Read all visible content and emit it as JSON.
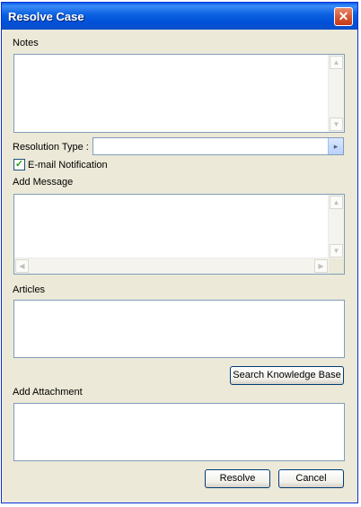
{
  "window": {
    "title": "Resolve Case",
    "close_glyph": "✕"
  },
  "notes": {
    "label": "Notes",
    "value": ""
  },
  "resolution": {
    "label": "Resolution Type :",
    "value": "",
    "arrow": "▸"
  },
  "email": {
    "label": "E-mail Notification",
    "checked": true,
    "check_glyph": "✓"
  },
  "message": {
    "label": "Add Message",
    "value": ""
  },
  "articles": {
    "label": "Articles"
  },
  "search_kb": {
    "label": "Search Knowledge Base"
  },
  "attachment": {
    "label": "Add Attachment"
  },
  "buttons": {
    "resolve": "Resolve",
    "cancel": "Cancel"
  },
  "scroll_glyphs": {
    "up": "▲",
    "down": "▼",
    "left": "◀",
    "right": "▶"
  }
}
